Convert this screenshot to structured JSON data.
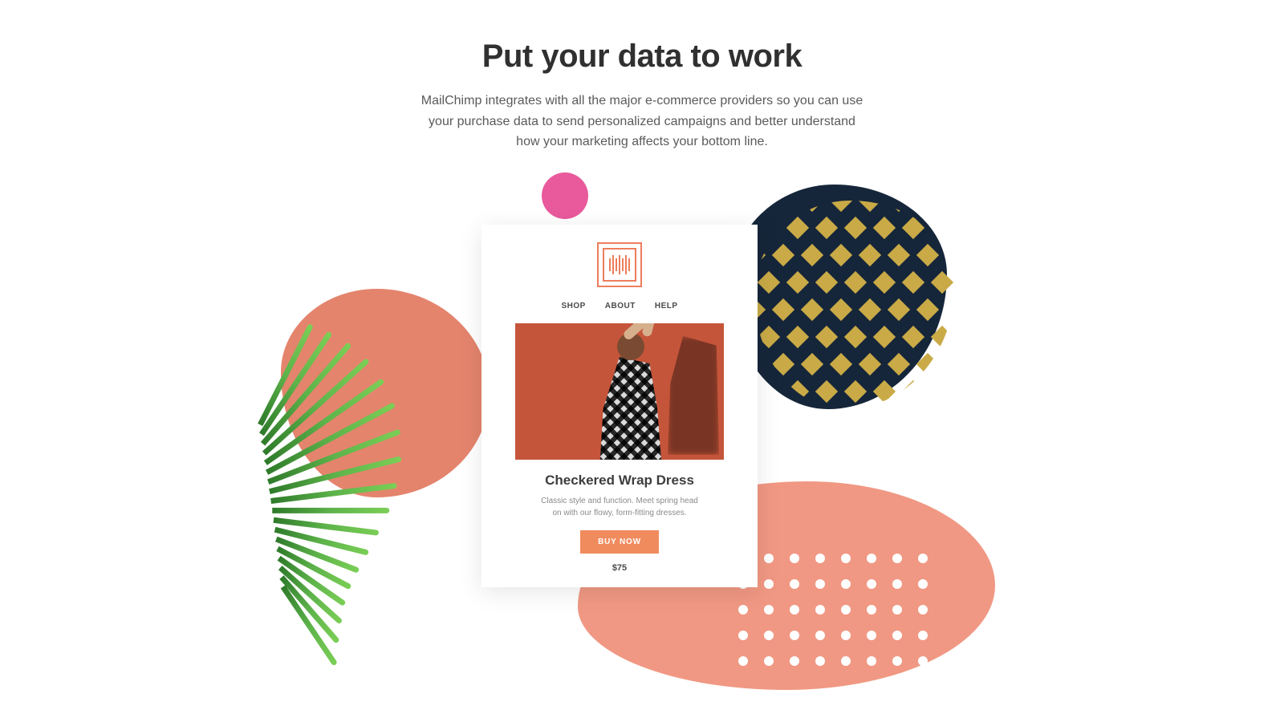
{
  "hero": {
    "title": "Put your data to work",
    "subtitle": "MailChimp integrates with all the major e-commerce providers so you can use your purchase data to send personalized campaigns and better understand how your marketing affects your bottom line."
  },
  "email_card": {
    "nav": [
      "SHOP",
      "ABOUT",
      "HELP"
    ],
    "product": {
      "title": "Checkered Wrap Dress",
      "description": "Classic style and function. Meet spring head on with our flowy, form-fitting dresses.",
      "cta": "BUY NOW",
      "price": "$75"
    }
  }
}
